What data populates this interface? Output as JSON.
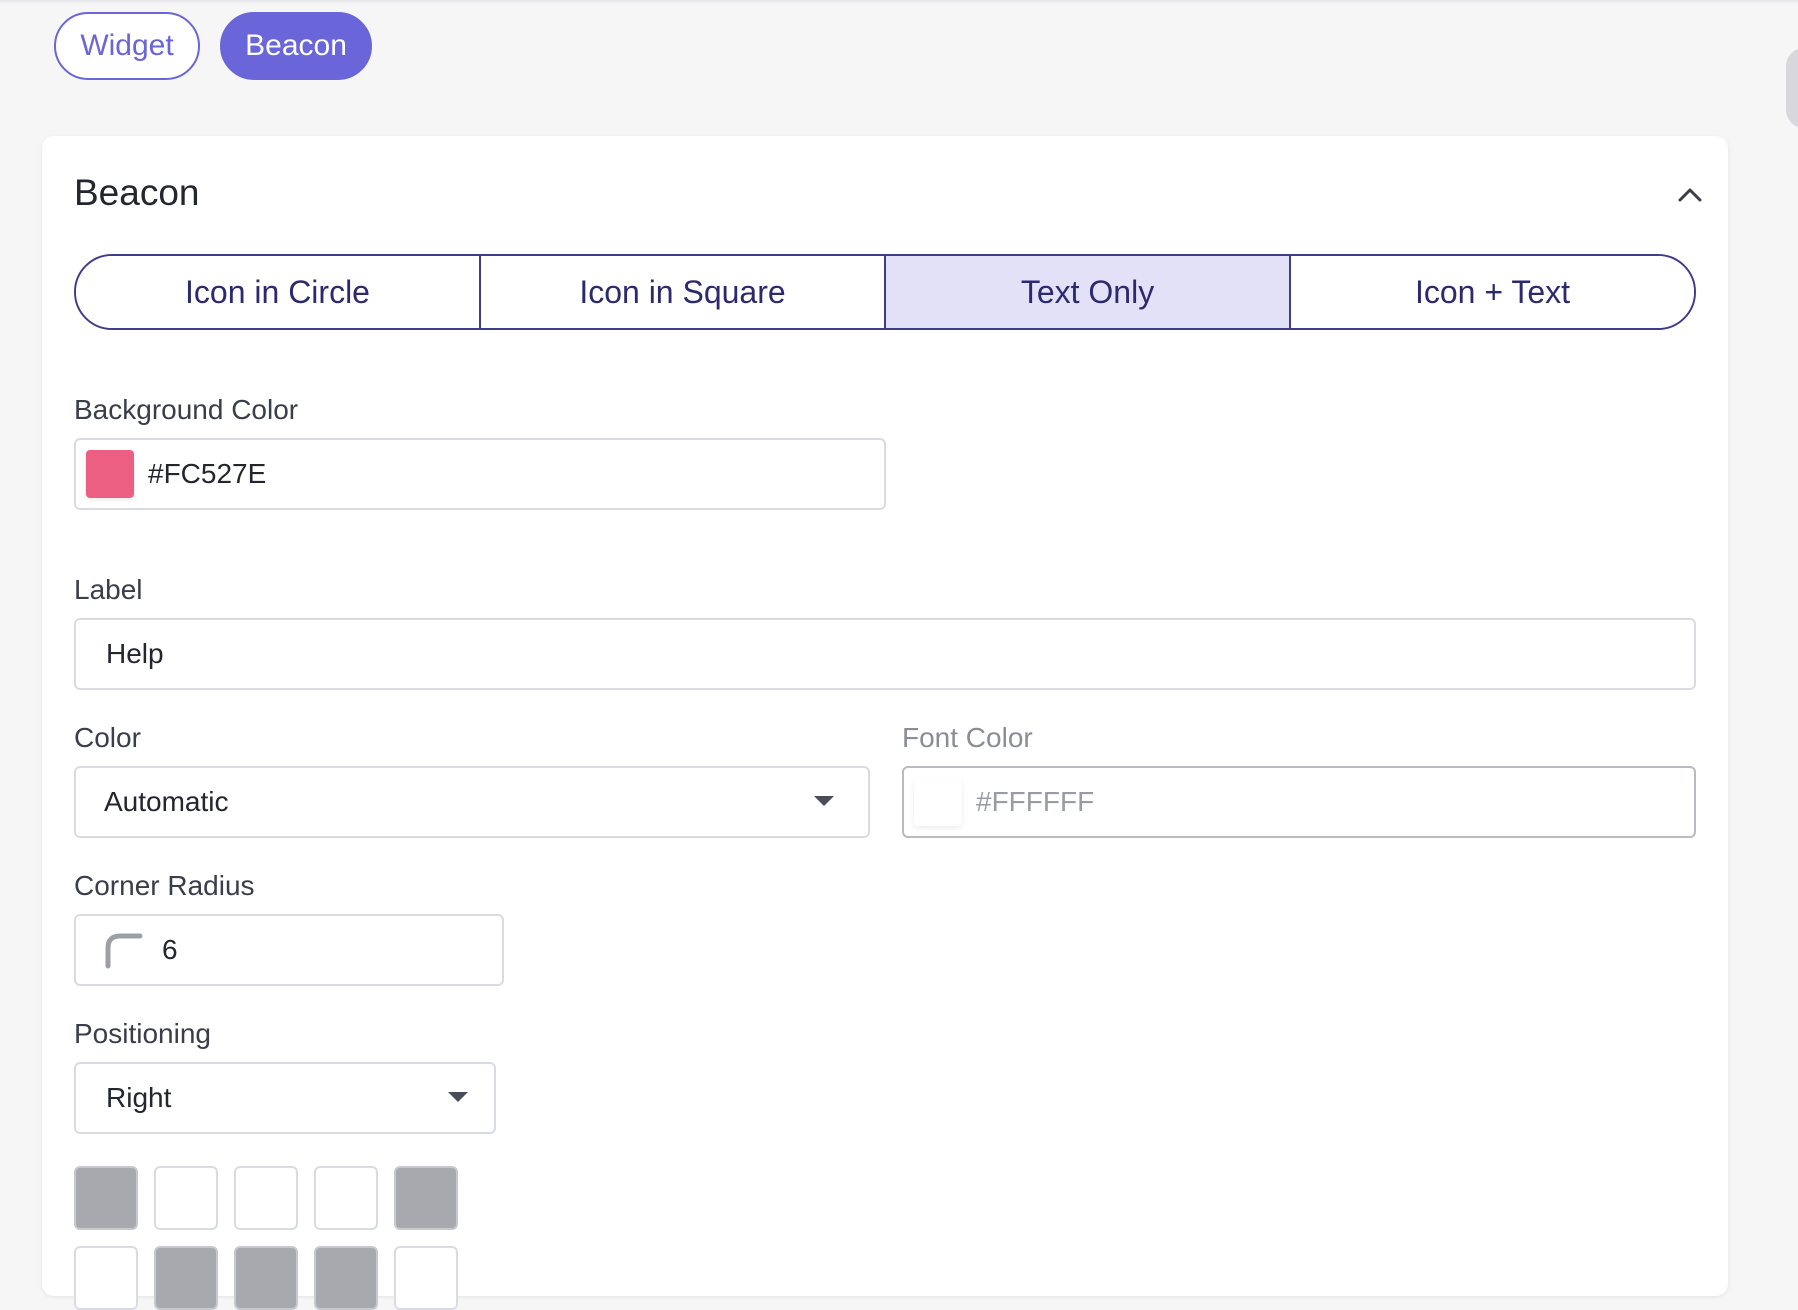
{
  "top_tabs": [
    {
      "label": "Widget",
      "selected": false
    },
    {
      "label": "Beacon",
      "selected": true
    }
  ],
  "card": {
    "title": "Beacon",
    "styles": [
      {
        "label": "Icon in Circle",
        "selected": false
      },
      {
        "label": "Icon in Square",
        "selected": false
      },
      {
        "label": "Text Only",
        "selected": true
      },
      {
        "label": "Icon + Text",
        "selected": false
      }
    ],
    "background_color": {
      "label": "Background Color",
      "value": "#FC527E",
      "swatch": "#EC5F82"
    },
    "label_field": {
      "label": "Label",
      "value": "Help"
    },
    "color": {
      "label": "Color",
      "value": "Automatic"
    },
    "font_color": {
      "label": "Font Color",
      "value": "#FFFFFF",
      "swatch": "#FFFFFF",
      "disabled": true
    },
    "corner_radius": {
      "label": "Corner Radius",
      "value": "6",
      "icon": "corner-radius-icon"
    },
    "positioning": {
      "label": "Positioning",
      "value": "Right",
      "grid_row_1": [
        true,
        false,
        false,
        false,
        true
      ],
      "grid_row_2": [
        false,
        true,
        true,
        true,
        false
      ]
    }
  },
  "colors": {
    "accent": "#6A65D8",
    "segment_border": "#3F3C8C",
    "segment_active_bg": "#E3E1F7",
    "grid_on": "#A8A9AE"
  }
}
